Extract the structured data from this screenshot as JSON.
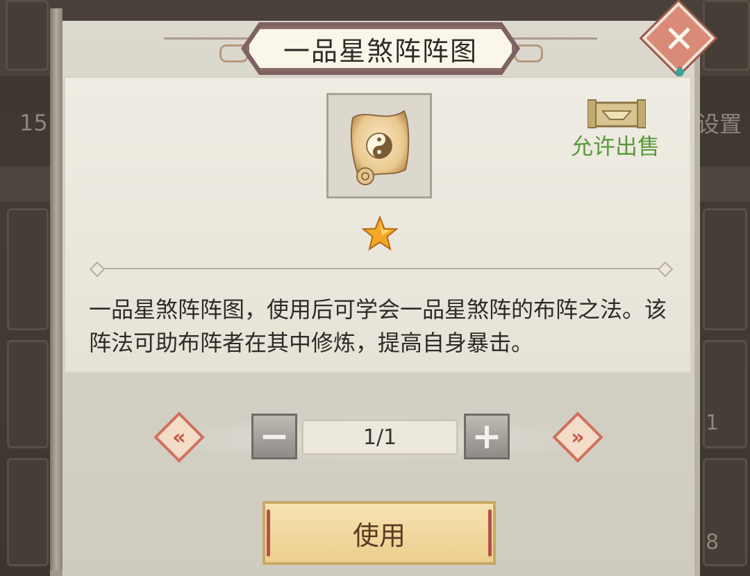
{
  "dialog": {
    "title": "一品星煞阵阵图",
    "close_icon": "close-icon"
  },
  "item": {
    "icon": "scroll-yin-yang-icon",
    "star_count": 1,
    "sell_status": "允许出售",
    "description": "一品星煞阵阵图，使用后可学会一品星煞阵的布阵之法。该阵法可助布阵者在其中修炼，提高自身暴击。"
  },
  "quantity": {
    "value": "1/1",
    "decrease_icon": "minus-icon",
    "increase_icon": "plus-icon",
    "prev_icon": "double-arrow-left-icon",
    "next_icon": "double-arrow-right-icon"
  },
  "actions": {
    "use_label": "使用"
  },
  "background": {
    "left_number": "15",
    "right_label": "设置",
    "side_num_1": "1",
    "side_num_2": "8"
  },
  "colors": {
    "sell_green": "#5a9a3d",
    "button_gold": "#eccf8d",
    "arrow_red": "#d0705c"
  }
}
